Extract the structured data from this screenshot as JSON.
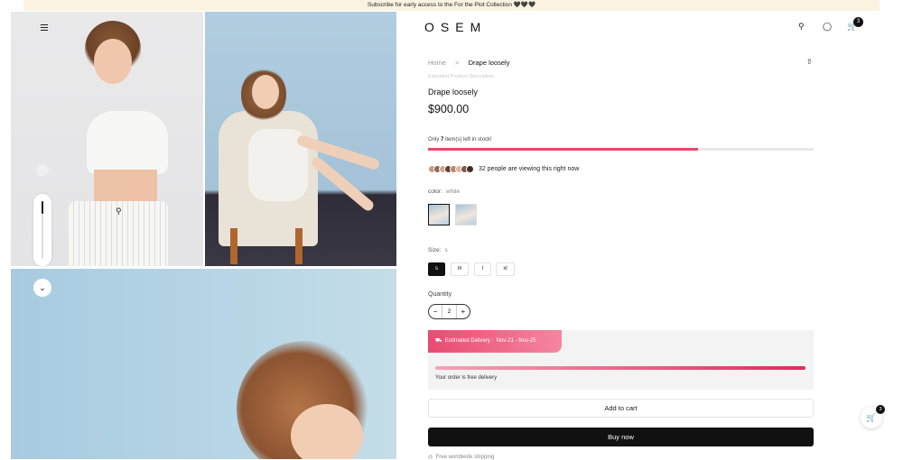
{
  "announcement": "Subscribe for early access to the For the Plot Collection 🖤🖤🖤",
  "header": {
    "logo": "OSEM",
    "cart_count": "3"
  },
  "breadcrumb": {
    "home": "Home",
    "separator": ">",
    "current": "Drape loosely"
  },
  "product": {
    "extended_link": "Extended Product Description",
    "title": "Drape loosely",
    "price": "$900.00",
    "stock_prefix": "Only ",
    "stock_count": "7",
    "stock_suffix": " item(s) left in stock!",
    "stock_fraction": 0.7,
    "viewers_text": "32 people are viewing this right now",
    "color_label": "color:",
    "color_value": "white",
    "size_label": "Size:",
    "size_value": "s",
    "sizes": [
      "s",
      "m",
      "l",
      "xl"
    ],
    "quantity_label": "Quantity",
    "quantity_value": "2",
    "quantity_minus": "−",
    "quantity_plus": "+"
  },
  "delivery": {
    "estimated_label": "Estimated Delivery :",
    "estimated_range": "Nov-21 - Nov-25",
    "free_text": "Your order is free delivery",
    "progress_fraction": 1.0,
    "accent": "#e94b72"
  },
  "actions": {
    "add_to_cart": "Add to cart",
    "buy_now": "Buy now",
    "shipping_note": "Free worldwide shipping"
  },
  "floating_cart": {
    "count": "3"
  },
  "colors": {
    "accent": "#e8476d",
    "announcement_bg": "#faf3e1",
    "primary": "#111111"
  }
}
